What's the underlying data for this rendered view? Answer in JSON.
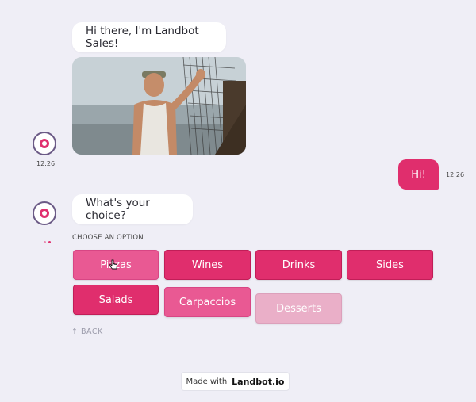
{
  "messages": {
    "greeting": "Hi there, I'm Landbot Sales!",
    "question": "What's your choice?",
    "user_reply": "Hi!"
  },
  "times": {
    "bot": "12:26",
    "user": "12:26"
  },
  "options": {
    "header": "CHOOSE AN OPTION",
    "items": [
      "Pizzas",
      "Wines",
      "Drinks",
      "Sides",
      "Salads",
      "Carpaccios",
      "Desserts"
    ]
  },
  "back_label": "BACK",
  "footer": {
    "prefix": "Made with",
    "brand": "Landbot.io"
  },
  "colors": {
    "accent": "#e02e6d",
    "background": "#efeef6"
  }
}
